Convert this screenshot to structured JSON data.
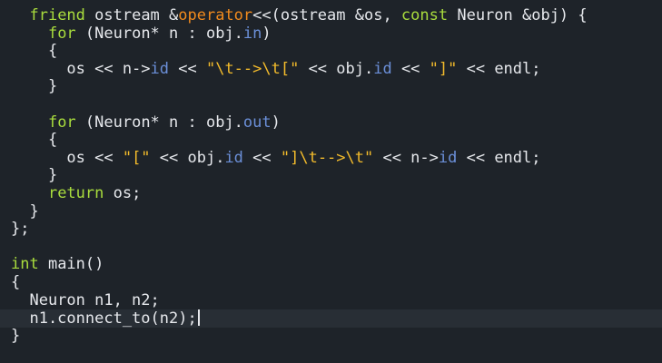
{
  "editor": {
    "lines": [
      [
        {
          "t": "  "
        },
        {
          "t": "friend",
          "c": "kw"
        },
        {
          "t": " ostream &"
        },
        {
          "t": "operator",
          "c": "fn"
        },
        {
          "t": "<<(ostream &os, "
        },
        {
          "t": "const",
          "c": "kw"
        },
        {
          "t": " Neuron &obj) {"
        }
      ],
      [
        {
          "t": "    "
        },
        {
          "t": "for",
          "c": "kw"
        },
        {
          "t": " (Neuron* n : obj."
        },
        {
          "t": "in",
          "c": "mem"
        },
        {
          "t": ")"
        }
      ],
      [
        {
          "t": "    {"
        }
      ],
      [
        {
          "t": "      os << n->"
        },
        {
          "t": "id",
          "c": "mem"
        },
        {
          "t": " << "
        },
        {
          "t": "\"\\t-->\\t[\"",
          "c": "str"
        },
        {
          "t": " << obj."
        },
        {
          "t": "id",
          "c": "mem"
        },
        {
          "t": " << "
        },
        {
          "t": "\"]\"",
          "c": "str"
        },
        {
          "t": " << endl;"
        }
      ],
      [
        {
          "t": "    }"
        }
      ],
      [
        {
          "t": ""
        }
      ],
      [
        {
          "t": "    "
        },
        {
          "t": "for",
          "c": "kw"
        },
        {
          "t": " (Neuron* n : obj."
        },
        {
          "t": "out",
          "c": "mem"
        },
        {
          "t": ")"
        }
      ],
      [
        {
          "t": "    {"
        }
      ],
      [
        {
          "t": "      os << "
        },
        {
          "t": "\"[\"",
          "c": "str"
        },
        {
          "t": " << obj."
        },
        {
          "t": "id",
          "c": "mem"
        },
        {
          "t": " << "
        },
        {
          "t": "\"]\\t-->\\t\"",
          "c": "str"
        },
        {
          "t": " << n->"
        },
        {
          "t": "id",
          "c": "mem"
        },
        {
          "t": " << endl;"
        }
      ],
      [
        {
          "t": "    }"
        }
      ],
      [
        {
          "t": "    "
        },
        {
          "t": "return",
          "c": "kw"
        },
        {
          "t": " os;"
        }
      ],
      [
        {
          "t": "  }"
        }
      ],
      [
        {
          "t": "};"
        }
      ],
      [
        {
          "t": ""
        }
      ],
      [
        {
          "t": "int",
          "c": "tp"
        },
        {
          "t": " main()"
        }
      ],
      [
        {
          "t": "{"
        }
      ],
      [
        {
          "t": "  Neuron n1, n2;"
        }
      ],
      [
        {
          "t": "  n1.connect_to(n2);"
        }
      ],
      [
        {
          "t": "}"
        }
      ]
    ],
    "current_line_index": 17,
    "cursor_after_text": true
  }
}
